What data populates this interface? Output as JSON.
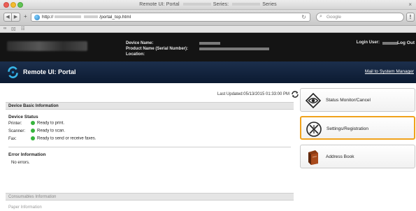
{
  "browser": {
    "window_title": "Remote UI: Portal",
    "series_label_1": "Series:",
    "series_label_2": "Series",
    "url_prefix": "http://",
    "url_suffix": "/portal_top.html",
    "search_placeholder": "Google",
    "back_icon": "back-arrow-icon",
    "forward_icon": "forward-arrow-icon",
    "reload_icon": "reload-icon"
  },
  "header": {
    "device_name_label": "Device Name:",
    "product_name_label": "Product Name (Serial Number):",
    "location_label": "Location:",
    "login_user_label": "Login User:",
    "logout_label": "Log Out"
  },
  "portal_bar": {
    "title": "Remote UI: Portal",
    "mail_link": "Mail to System Manager"
  },
  "main": {
    "last_updated": "Last Updated:05/13/2015 01:33:00 PM",
    "device_basic_info": {
      "heading": "Device Basic Information",
      "status_heading": "Device Status",
      "rows": [
        {
          "label": "Printer:",
          "value": "Ready to print."
        },
        {
          "label": "Scanner:",
          "value": "Ready to scan."
        },
        {
          "label": "Fax:",
          "value": "Ready to send or receive faxes."
        }
      ],
      "error_heading": "Error Information",
      "error_text": "No errors."
    },
    "consumables": {
      "heading": "Consumables Information",
      "paper_heading": "Paper Information"
    }
  },
  "right_panel": [
    {
      "label": "Status Monitor/Cancel",
      "icon": "status-monitor-icon",
      "active": false
    },
    {
      "label": "Settings/Registration",
      "icon": "settings-registration-icon",
      "active": true
    },
    {
      "label": "Address Book",
      "icon": "address-book-icon",
      "active": false
    }
  ],
  "colors": {
    "header_bg": "#141414",
    "portal_bar_bg": "#13243f",
    "status_ok": "#37b43d",
    "active_border": "#f0a21b"
  }
}
